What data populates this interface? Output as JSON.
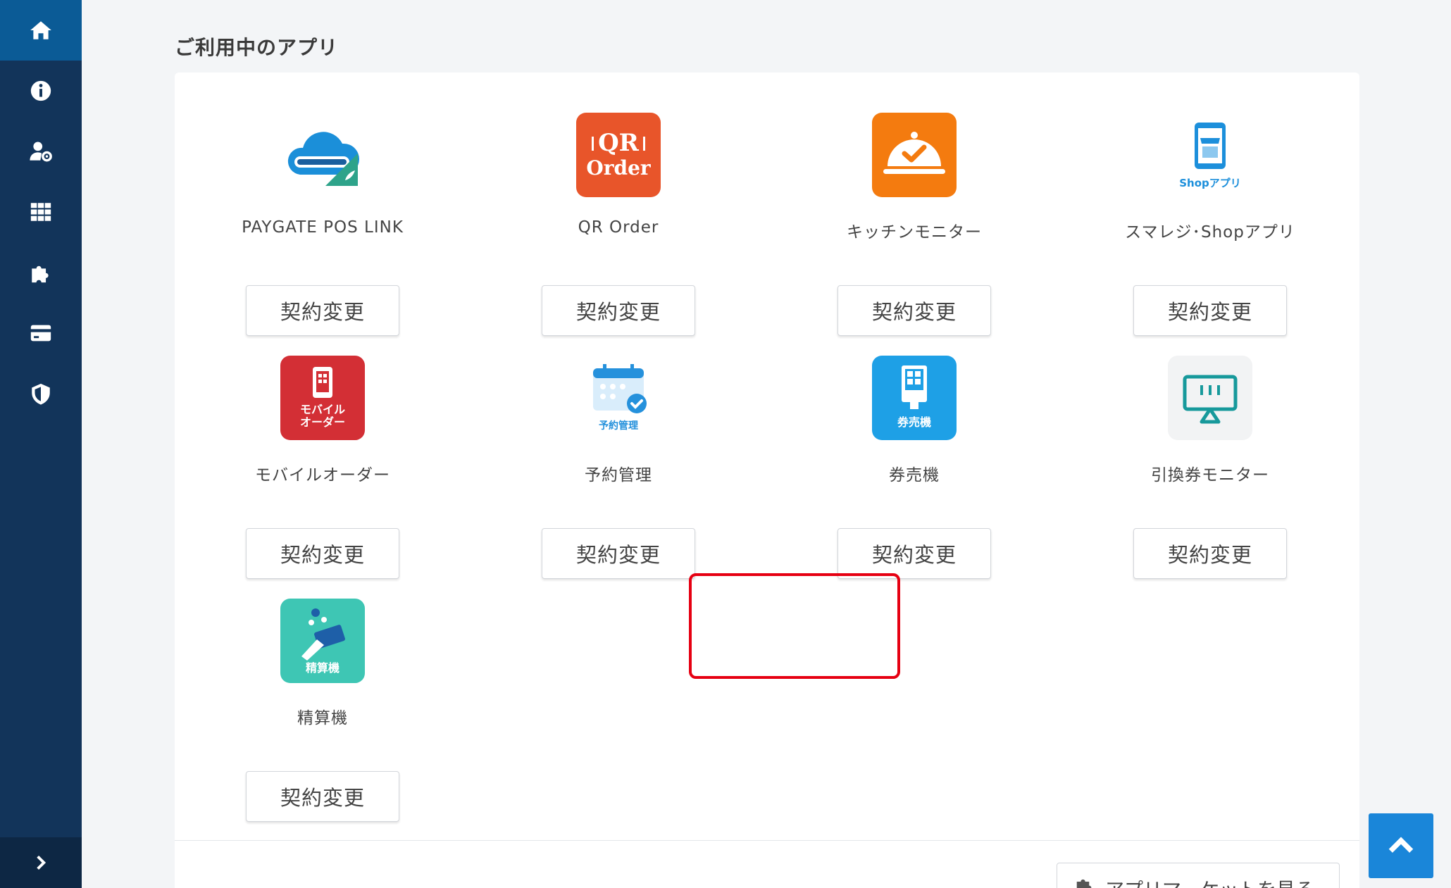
{
  "section": {
    "title": "ご利用中のアプリ"
  },
  "apps": [
    {
      "name": "PAYGATE POS LINK",
      "button": "契約変更",
      "icon": "paygate-cloud-icon"
    },
    {
      "name": "QR Order",
      "button": "契約変更",
      "icon": "qr-order-icon",
      "icon_text_1": "QR",
      "icon_text_2": "Order",
      "color": "#e8552a"
    },
    {
      "name": "キッチンモニター",
      "button": "契約変更",
      "icon": "kitchen-monitor-icon",
      "color": "#f47b0f"
    },
    {
      "name": "スマレジ･Shopアプリ",
      "button": "契約変更",
      "icon": "shop-app-icon",
      "icon_text": "Shopアプリ"
    },
    {
      "name": "モバイルオーダー",
      "button": "契約変更",
      "icon": "mobile-order-icon",
      "icon_text_1": "モバイル",
      "icon_text_2": "オーダー",
      "color": "#d32f35"
    },
    {
      "name": "予約管理",
      "button": "契約変更",
      "icon": "reservation-icon",
      "icon_text": "予約管理"
    },
    {
      "name": "券売機",
      "button": "契約変更",
      "icon": "ticket-machine-icon",
      "icon_text": "券売機",
      "color": "#1ea0e6"
    },
    {
      "name": "引換券モニター",
      "button": "契約変更",
      "icon": "voucher-monitor-icon"
    },
    {
      "name": "精算機",
      "button": "契約変更",
      "icon": "payment-machine-icon",
      "icon_text": "精算機",
      "color": "#3ec6b4"
    }
  ],
  "market_button": "アプリマーケットを見る",
  "sidebar": {
    "items": [
      "home-icon",
      "info-icon",
      "user-settings-icon",
      "apps-grid-icon",
      "puzzle-icon",
      "credit-card-icon",
      "shield-icon"
    ],
    "toggle": "chevron-right-icon"
  },
  "colors": {
    "sidebar": "#12345a",
    "active": "#0b5b96",
    "accent": "#1a86d9",
    "highlight": "#e60012"
  }
}
